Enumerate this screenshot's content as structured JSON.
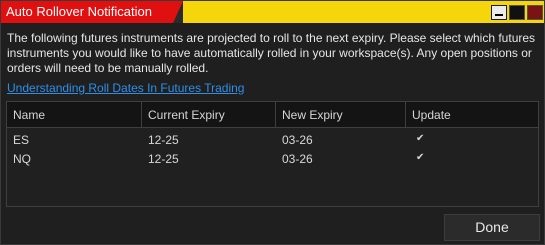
{
  "window": {
    "title": "Auto Rollover Notification",
    "accent_color": "#e01010",
    "title_bar_color": "#f4d60a"
  },
  "description": "The following futures instruments are projected to roll to the next expiry. Please select which futures instruments you would like to have automatically rolled in your workspace(s). Any open positions or orders will need to be manually rolled.",
  "link": {
    "label": "Understanding Roll Dates In Futures Trading"
  },
  "table": {
    "columns": [
      "Name",
      "Current Expiry",
      "New Expiry",
      "Update"
    ],
    "rows": [
      {
        "name": "ES",
        "current_expiry": "12-25",
        "new_expiry": "03-26",
        "update": true
      },
      {
        "name": "NQ",
        "current_expiry": "12-25",
        "new_expiry": "03-26",
        "update": true
      }
    ]
  },
  "footer": {
    "done_label": "Done"
  }
}
